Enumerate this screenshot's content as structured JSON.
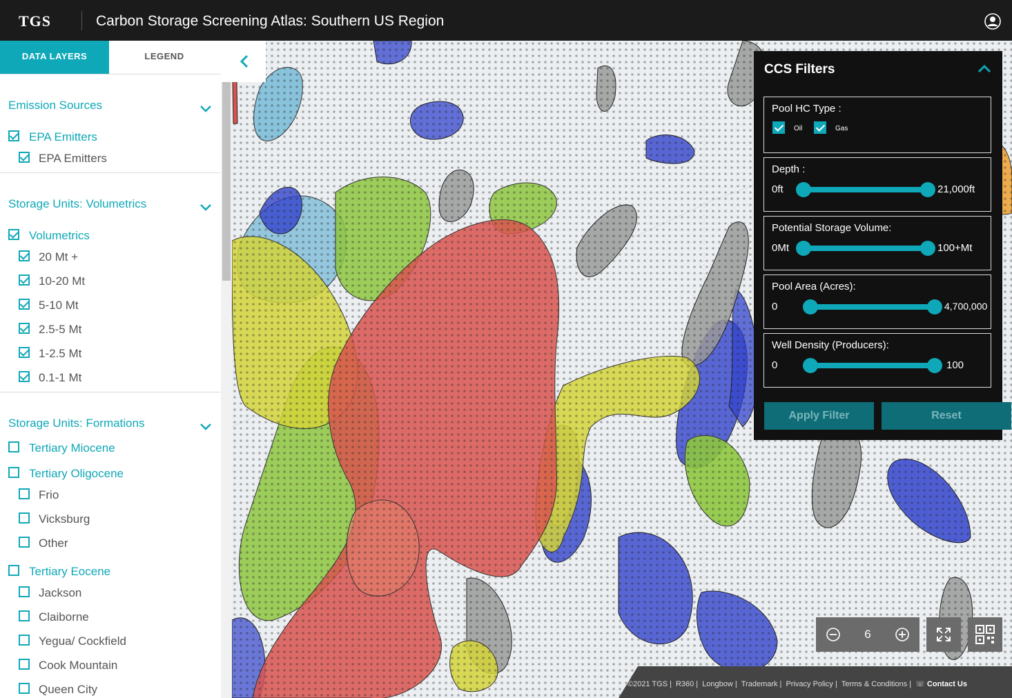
{
  "header": {
    "logo": "TGS",
    "title": "Carbon Storage Screening Atlas: Southern US Region"
  },
  "tabs": {
    "data_layers": "DATA LAYERS",
    "legend": "LEGEND"
  },
  "sections": {
    "emission": {
      "title": "Emission Sources",
      "parent": "EPA Emitters",
      "children": [
        "EPA Emitters"
      ]
    },
    "volumetrics": {
      "title": "Storage Units: Volumetrics",
      "parent": "Volumetrics",
      "children": [
        "20 Mt +",
        "10-20 Mt",
        "5-10 Mt",
        "2.5-5 Mt",
        "1-2.5 Mt",
        "0.1-1 Mt"
      ]
    },
    "formations": {
      "title": "Storage Units: Formations",
      "miocene": "Tertiary Miocene",
      "oligocene": "Tertiary Oligocene",
      "oligocene_children": [
        "Frio",
        "Vicksburg",
        "Other"
      ],
      "eocene": "Tertiary Eocene",
      "eocene_children": [
        "Jackson",
        "Claiborne",
        "Yegua/ Cockfield",
        "Cook Mountain",
        "Queen City"
      ]
    }
  },
  "filters": {
    "title": "CCS Filters",
    "pool_hc_type": {
      "label": "Pool HC Type :",
      "oil": "Oil",
      "gas": "Gas",
      "oil_checked": true,
      "gas_checked": true
    },
    "depth": {
      "label": "Depth :",
      "min": "0ft",
      "max": "21,000ft"
    },
    "storage_volume": {
      "label": "Potential Storage Volume:",
      "min": "0Mt",
      "max": "100+Mt"
    },
    "pool_area": {
      "label": "Pool Area (Acres):",
      "min": "0",
      "max": "4,700,000"
    },
    "well_density": {
      "label": "Well Density (Producers):",
      "min": "0",
      "max": "100"
    },
    "apply": "Apply Filter",
    "reset": "Reset"
  },
  "map_controls": {
    "zoom_level": "6"
  },
  "footer": {
    "links": [
      "©2021 TGS",
      "R360",
      "Longbow",
      "Trademark",
      "Privacy Policy",
      "Terms & Conditions",
      "Contact Us"
    ]
  },
  "colors": {
    "accent": "#0fa8b8",
    "header_bg": "#1b1b1b",
    "red_unit": "#d9534f",
    "yellow_unit": "#d4d43a",
    "green_unit": "#8ec63f",
    "blue_unit": "#3344cc",
    "light_blue_unit": "#6fb6d6",
    "gray_unit": "#9a9a9a"
  }
}
